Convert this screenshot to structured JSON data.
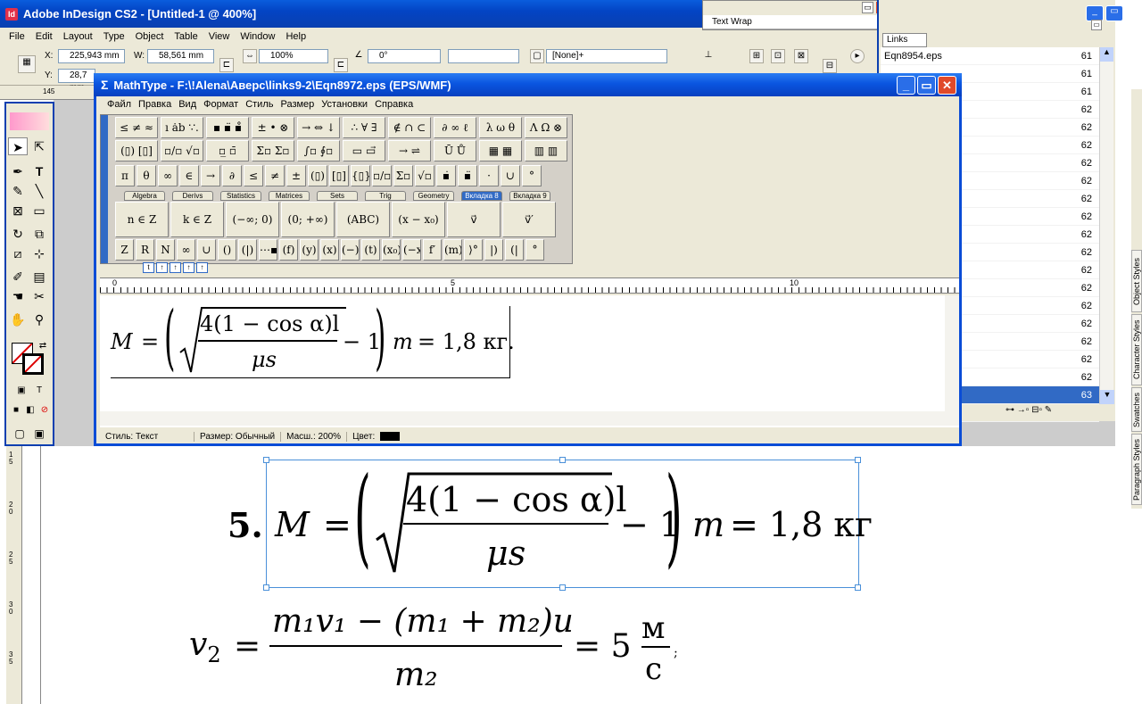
{
  "indesign": {
    "title": "Adobe InDesign CS2 - [Untitled-1 @ 400%]",
    "logo_text": "Id",
    "menu": [
      "File",
      "Edit",
      "Layout",
      "Type",
      "Object",
      "Table",
      "View",
      "Window",
      "Help"
    ],
    "control": {
      "x_label": "X:",
      "x_value": "225,943 mm",
      "y_label": "Y:",
      "y_value": "28,7 mm",
      "w_label": "W:",
      "w_value": "58,561 mm",
      "scale_value": "100%",
      "angle_value": "0°",
      "style_value": "[None]+"
    },
    "ruler_top_mark": "145"
  },
  "text_wrap": {
    "title": "Text Wrap"
  },
  "links": {
    "tab": "Links",
    "rows": [
      {
        "name": "Eqn8954.eps",
        "page": "61"
      },
      {
        "name": "",
        "page": "61"
      },
      {
        "name": "",
        "page": "61"
      },
      {
        "name": "",
        "page": "62"
      },
      {
        "name": "",
        "page": "62"
      },
      {
        "name": "",
        "page": "62"
      },
      {
        "name": "",
        "page": "62"
      },
      {
        "name": "",
        "page": "62"
      },
      {
        "name": "",
        "page": "62"
      },
      {
        "name": "",
        "page": "62"
      },
      {
        "name": "",
        "page": "62"
      },
      {
        "name": "",
        "page": "62"
      },
      {
        "name": "",
        "page": "62"
      },
      {
        "name": "",
        "page": "62"
      },
      {
        "name": "",
        "page": "62"
      },
      {
        "name": "",
        "page": "62"
      },
      {
        "name": "",
        "page": "62"
      },
      {
        "name": "",
        "page": "62"
      },
      {
        "name": "",
        "page": "62"
      },
      {
        "name": "",
        "page": "63"
      },
      {
        "name": "",
        "page": "63"
      }
    ],
    "selected_index": 19,
    "bottom_icons": "⊶ →▫ ⊟▫ ✎"
  },
  "side_tabs": [
    "Object Styles",
    "Character Styles",
    "Swatches",
    "Paragraph Styles"
  ],
  "mathtype": {
    "title": "MathType - F:\\!Alena\\Аверс\\links9-2\\Eqn8972.eps (EPS/WMF)",
    "title_icon": "Σ",
    "menu": [
      "Файл",
      "Правка",
      "Вид",
      "Формат",
      "Стиль",
      "Размер",
      "Установки",
      "Справка"
    ],
    "palette_row1": [
      "≤ ≠ ≈",
      "ı ȧb ∵.",
      "▪ ▪̈ ▪̊",
      "± • ⊗",
      "→ ⇔ ↓",
      "∴ ∀ ∃",
      "∉ ∩ ⊂",
      "∂ ∞ ℓ",
      "λ ω θ",
      "Λ Ω ⊗"
    ],
    "palette_row2": [
      "(▯) [▯]",
      "▫/▫ √▫",
      "▫̲ ▫̄",
      "Σ▫ Σ▫",
      "∫▫ ∮▫",
      "▭ ▭⃗",
      "→ ⇌",
      "Ū Ů",
      "▦ ▦",
      "▥ ▥"
    ],
    "palette_row3": [
      "π",
      "θ",
      "∞",
      "∈",
      "→",
      "∂",
      "≤",
      "≠",
      "±",
      "(▯)",
      "[▯]",
      "{▯}",
      "▫/▫",
      "Σ▫",
      "√▫",
      "▪̇",
      "▪̈",
      "·",
      "∪",
      "°"
    ],
    "tabs": [
      "Algebra",
      "Derivs",
      "Statistics",
      "Matrices",
      "Sets",
      "Trig",
      "Geometry",
      "Вкладка 8",
      "Вкладка 9"
    ],
    "active_tab": 7,
    "palette_row4": [
      "n ∈ Z",
      "k ∈ Z",
      "(−∞; 0)",
      "(0; +∞)",
      "(ABC)",
      "(x − x₀)",
      "v⃗",
      "v⃗′"
    ],
    "palette_row5": [
      "Z",
      "R",
      "N",
      "∞",
      "∪",
      "()",
      "(|)",
      "⋯▪",
      "(f)",
      "(y)",
      "(x)",
      "(−)",
      "(t)",
      "(x₀)",
      "(−x)",
      "f′",
      "(m)",
      "⟩°",
      "|)",
      "(|",
      "°"
    ],
    "size_buttons": [
      "t",
      "↑",
      "↑",
      "↑",
      "↑"
    ],
    "ruler_marks": [
      "0",
      "5",
      "10"
    ],
    "equation": {
      "lhs": "M",
      "eq": "=",
      "numerator": "4(1 − cos α)l",
      "denominator": "μs",
      "minus_one": "− 1",
      "m": "m",
      "rhs": "= 1,8 кг."
    },
    "status": {
      "style": "Стиль: Текст",
      "size": "Размер: Обычный",
      "zoom": "Масш.: 200%",
      "color_label": "Цвет:"
    }
  },
  "document": {
    "eq5": {
      "number": "5.",
      "lhs": "M",
      "eq": "=",
      "numerator": "4(1 − cos α)l",
      "denominator": "μs",
      "minus_one": "− 1",
      "m": "m",
      "rhs": "= 1,8 кг"
    },
    "eq6": {
      "lhs": "v",
      "lhs_sub": "2",
      "eq": "=",
      "num": "m₁v₁ − (m₁ + m₂)u",
      "den": "m₂",
      "result": "= 5",
      "unit_num": "м",
      "unit_den": "с",
      "trail": ";"
    },
    "left_ruler_marks": [
      "1 5",
      "2 0",
      "2 5",
      "3 0",
      "3 5"
    ]
  }
}
